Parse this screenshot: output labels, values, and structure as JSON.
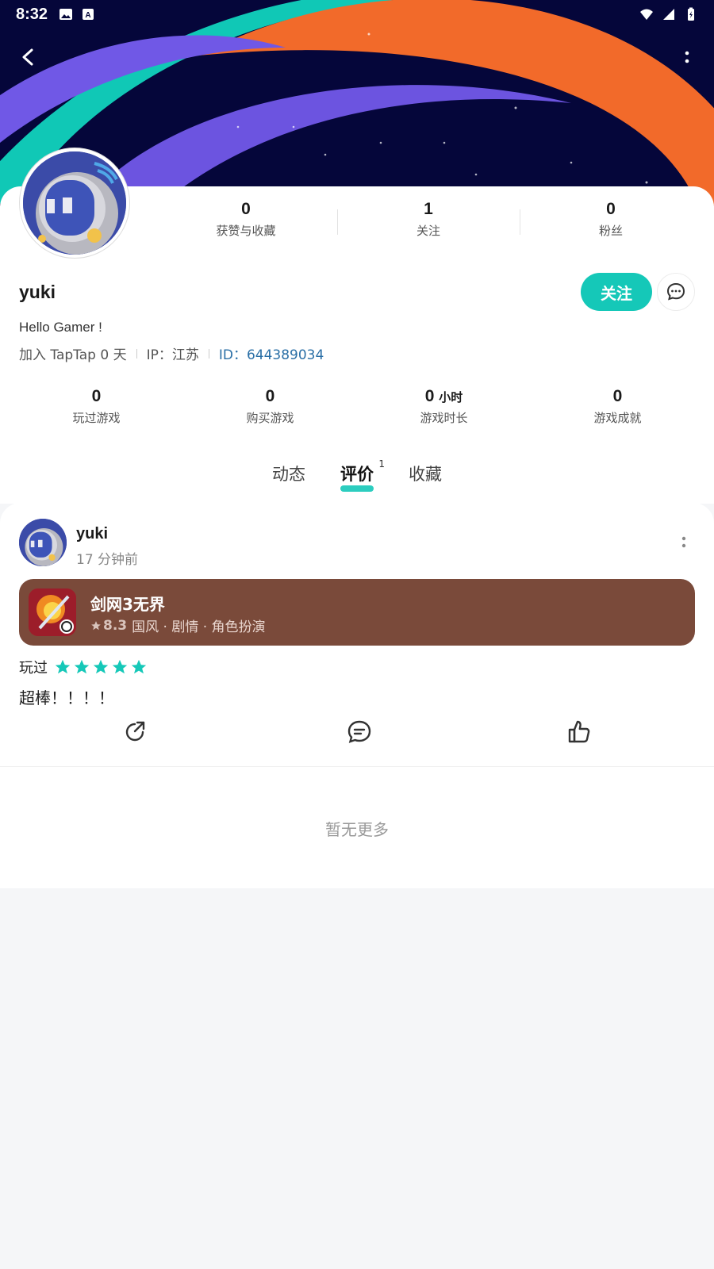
{
  "status_bar": {
    "time": "8:32"
  },
  "profile": {
    "stats": [
      {
        "value": "0",
        "label": "获赞与收藏"
      },
      {
        "value": "1",
        "label": "关注"
      },
      {
        "value": "0",
        "label": "粉丝"
      }
    ],
    "username": "yuki",
    "follow_label": "关注",
    "bio": "Hello Gamer !",
    "joined": "加入 TapTap 0 天",
    "ip": "IP：江苏",
    "id": "ID：644389034"
  },
  "game_stats": [
    {
      "value": "0",
      "unit": "",
      "label": "玩过游戏"
    },
    {
      "value": "0",
      "unit": "",
      "label": "购买游戏"
    },
    {
      "value": "0",
      "unit": "小时",
      "label": "游戏时长"
    },
    {
      "value": "0",
      "unit": "",
      "label": "游戏成就"
    }
  ],
  "tabs": [
    {
      "label": "动态"
    },
    {
      "label": "评价",
      "count": "1"
    },
    {
      "label": "收藏"
    }
  ],
  "review": {
    "author": "yuki",
    "time": "17 分钟前",
    "game": {
      "title": "剑网3无界",
      "rating": "8.3",
      "tags": "国风 · 剧情 · 角色扮演"
    },
    "played_label": "玩过",
    "stars": 5,
    "text": "超棒！！！！"
  },
  "footer_text": "暂无更多",
  "colors": {
    "accent": "#15c8b8",
    "game_card_bg": "#7a4a3a",
    "id_link": "#2a6fa6"
  }
}
